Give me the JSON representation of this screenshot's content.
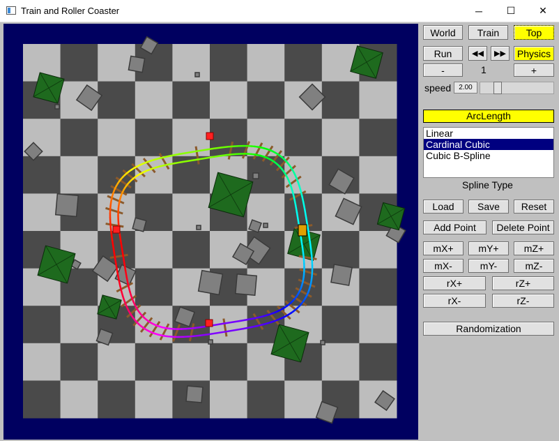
{
  "window": {
    "title": "Train and Roller Coaster",
    "minimize": "─",
    "maximize": "☐",
    "close": "✕"
  },
  "camera": {
    "world": "World",
    "train": "Train",
    "top": "Top",
    "active": "top"
  },
  "playback": {
    "run": "Run",
    "rewind": "◀◀",
    "forward": "▶▶",
    "physics": "Physics",
    "physics_on": true
  },
  "cars": {
    "minus": "-",
    "count": "1",
    "plus": "+"
  },
  "speed": {
    "label": "speed",
    "value": "2.00",
    "slider_fraction": 0.2
  },
  "arclength": {
    "label": "ArcLength",
    "on": true
  },
  "spline": {
    "options": [
      "Linear",
      "Cardinal Cubic",
      "Cubic B-Spline"
    ],
    "selected_index": 1,
    "caption": "Spline Type"
  },
  "file": {
    "load": "Load",
    "save": "Save",
    "reset": "Reset"
  },
  "points": {
    "add": "Add Point",
    "delete": "Delete Point"
  },
  "move": {
    "mx_plus": "mX+",
    "my_plus": "mY+",
    "mz_plus": "mZ+",
    "mx_minus": "mX-",
    "my_minus": "mY-",
    "mz_minus": "mZ-"
  },
  "rotate": {
    "rx_plus": "rX+",
    "rz_plus": "rZ+",
    "rx_minus": "rX-",
    "rz_minus": "rZ-"
  },
  "randomize": {
    "label": "Randomization"
  },
  "scene": {
    "colors": {
      "background": "#000060",
      "light_tile": "#bdbdbd",
      "dark_tile": "#4a4a4a",
      "cube": "#808080",
      "tree": "#1e6a1e",
      "control_point": "#ff2020",
      "train_car": "#e0a000"
    }
  }
}
